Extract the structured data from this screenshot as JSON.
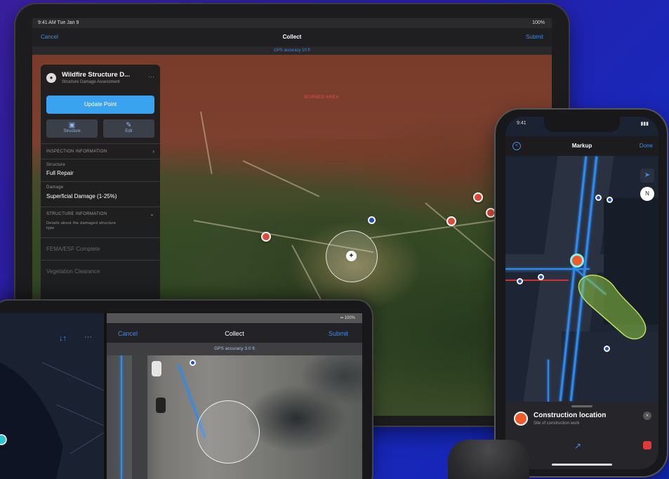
{
  "ipad": {
    "status": {
      "time": "9:41 AM Tue Jan 9",
      "battery": "100%"
    },
    "nav": {
      "cancel": "Cancel",
      "title": "Collect",
      "submit": "Submit"
    },
    "gps_banner": "GPS accuracy 10 ft",
    "map_label": "BURNED AREA",
    "panel": {
      "title": "Wildfire Structure D...",
      "subtitle": "Structure Damage Assessment",
      "more": "···",
      "update_button": "Update Point",
      "action_1": "Structure",
      "action_2": "Edit",
      "section_1": "INSPECTION INFORMATION",
      "field_1_label": "Structure",
      "field_1_value": "Full Repair",
      "field_2_label": "Damage",
      "field_2_value": "Superficial Damage (1-25%)",
      "section_2": "STRUCTURE INFORMATION",
      "section_2_note": "Details about the damaged structure type",
      "muted_1": "FEMA/ESF Complete",
      "muted_2": "Vegetation Clearance"
    }
  },
  "iphone": {
    "status": {
      "time": "9:41",
      "battery": "▮▮▮"
    },
    "nav": {
      "back": "<",
      "title": "Markup",
      "done": "Done"
    },
    "sheet": {
      "title": "Construction location",
      "subtitle": "Site of construction work",
      "close": "×"
    },
    "compass": "N"
  },
  "ipad2": {
    "status": "▪▪ 100%",
    "nav": {
      "cancel": "Cancel",
      "title": "Collect",
      "submit": "Submit"
    },
    "gps_banner": "GPS accuracy 3.0 ft",
    "toolbar_sort": "↓↑",
    "toolbar_more": "···"
  },
  "colors": {
    "accent": "#3a8ee6",
    "update_button": "#3aa3f0",
    "marker_red": "#e04a3a",
    "marker_orange": "#f05a28",
    "line_blue": "#2d8bf0",
    "polygon_green": "#8dc63f",
    "background": "#1a27b8"
  },
  "icons": [
    "chevron-right-icon",
    "location-icon",
    "compass-icon",
    "navigation-arrow-icon",
    "trash-icon",
    "close-icon"
  ]
}
